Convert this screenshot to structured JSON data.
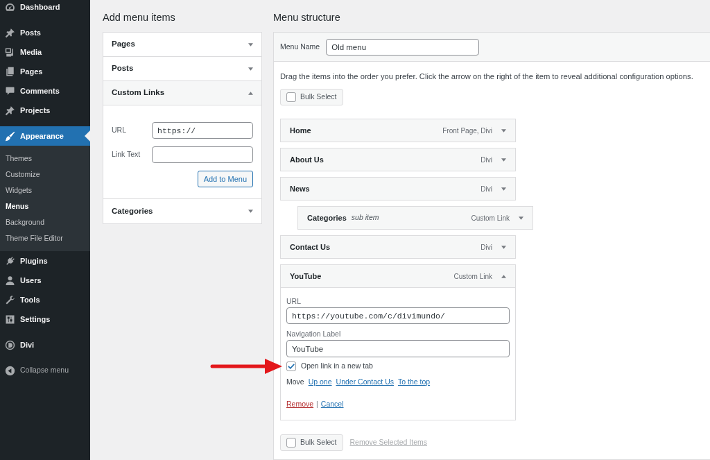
{
  "sidebar": {
    "groups": [
      {
        "items": [
          {
            "label": "Dashboard",
            "selected": false
          }
        ]
      },
      {
        "items": [
          {
            "label": "Posts",
            "selected": false
          },
          {
            "label": "Media",
            "selected": false
          },
          {
            "label": "Pages",
            "selected": false
          },
          {
            "label": "Comments",
            "selected": false
          },
          {
            "label": "Projects",
            "selected": false
          }
        ]
      },
      {
        "items": [
          {
            "label": "Appearance",
            "selected": true,
            "children": [
              {
                "label": "Themes",
                "selected": false
              },
              {
                "label": "Customize",
                "selected": false
              },
              {
                "label": "Widgets",
                "selected": false
              },
              {
                "label": "Menus",
                "selected": true
              },
              {
                "label": "Background",
                "selected": false
              },
              {
                "label": "Theme File Editor",
                "selected": false
              }
            ]
          },
          {
            "label": "Plugins",
            "selected": false
          },
          {
            "label": "Users",
            "selected": false
          },
          {
            "label": "Tools",
            "selected": false
          },
          {
            "label": "Settings",
            "selected": false
          }
        ]
      },
      {
        "items": [
          {
            "label": "Divi",
            "selected": false
          }
        ]
      }
    ],
    "collapse_button": {
      "label": "Collapse menu"
    }
  },
  "add_menu_items": {
    "title": "Add menu items",
    "sections": [
      {
        "title": "Pages",
        "expanded": false
      },
      {
        "title": "Posts",
        "expanded": false
      },
      {
        "title": "Custom Links",
        "expanded": true,
        "fields": [
          {
            "label": "URL",
            "value": "https://"
          },
          {
            "label": "Link Text"
          }
        ],
        "button": "Add to Menu"
      },
      {
        "title": "Categories",
        "expanded": false
      }
    ]
  },
  "menu_structure": {
    "title": "Menu structure",
    "menu_name": {
      "label": "Menu Name",
      "value": "Old menu"
    },
    "instructions": "Drag the items into the order you prefer. Click the arrow on the right of the item to reveal additional configuration options.",
    "bulk_select_top": {
      "label": "Bulk Select",
      "checked": false
    },
    "items": [
      {
        "title": "Home",
        "type": "Front Page, Divi",
        "expanded": false
      },
      {
        "title": "About Us",
        "type": "Divi",
        "expanded": false
      },
      {
        "title": "News",
        "type": "Divi",
        "expanded": false,
        "children": [
          {
            "title": "Categories",
            "note": "sub item",
            "type": "Custom Link",
            "expanded": false
          }
        ]
      },
      {
        "title": "Contact Us",
        "type": "Divi",
        "expanded": false
      },
      {
        "title": "YouTube",
        "type": "Custom Link",
        "expanded": true,
        "settings": {
          "url_label": "URL",
          "url": "https://youtube.com/c/divimundo/",
          "nav_label_label": "Navigation Label",
          "nav_label": "YouTube",
          "new_tab": {
            "label": "Open link in a new tab",
            "checked": true
          },
          "move": {
            "label": "Move",
            "links": [
              "Up one",
              "Under Contact Us",
              "To the top"
            ]
          },
          "remove": "Remove",
          "separator": "|",
          "cancel": "Cancel"
        }
      }
    ],
    "bulk_select_bottom": {
      "label": "Bulk Select",
      "checked": false
    },
    "remove_selected": {
      "label": "Remove Selected Items",
      "disabled": true
    }
  }
}
